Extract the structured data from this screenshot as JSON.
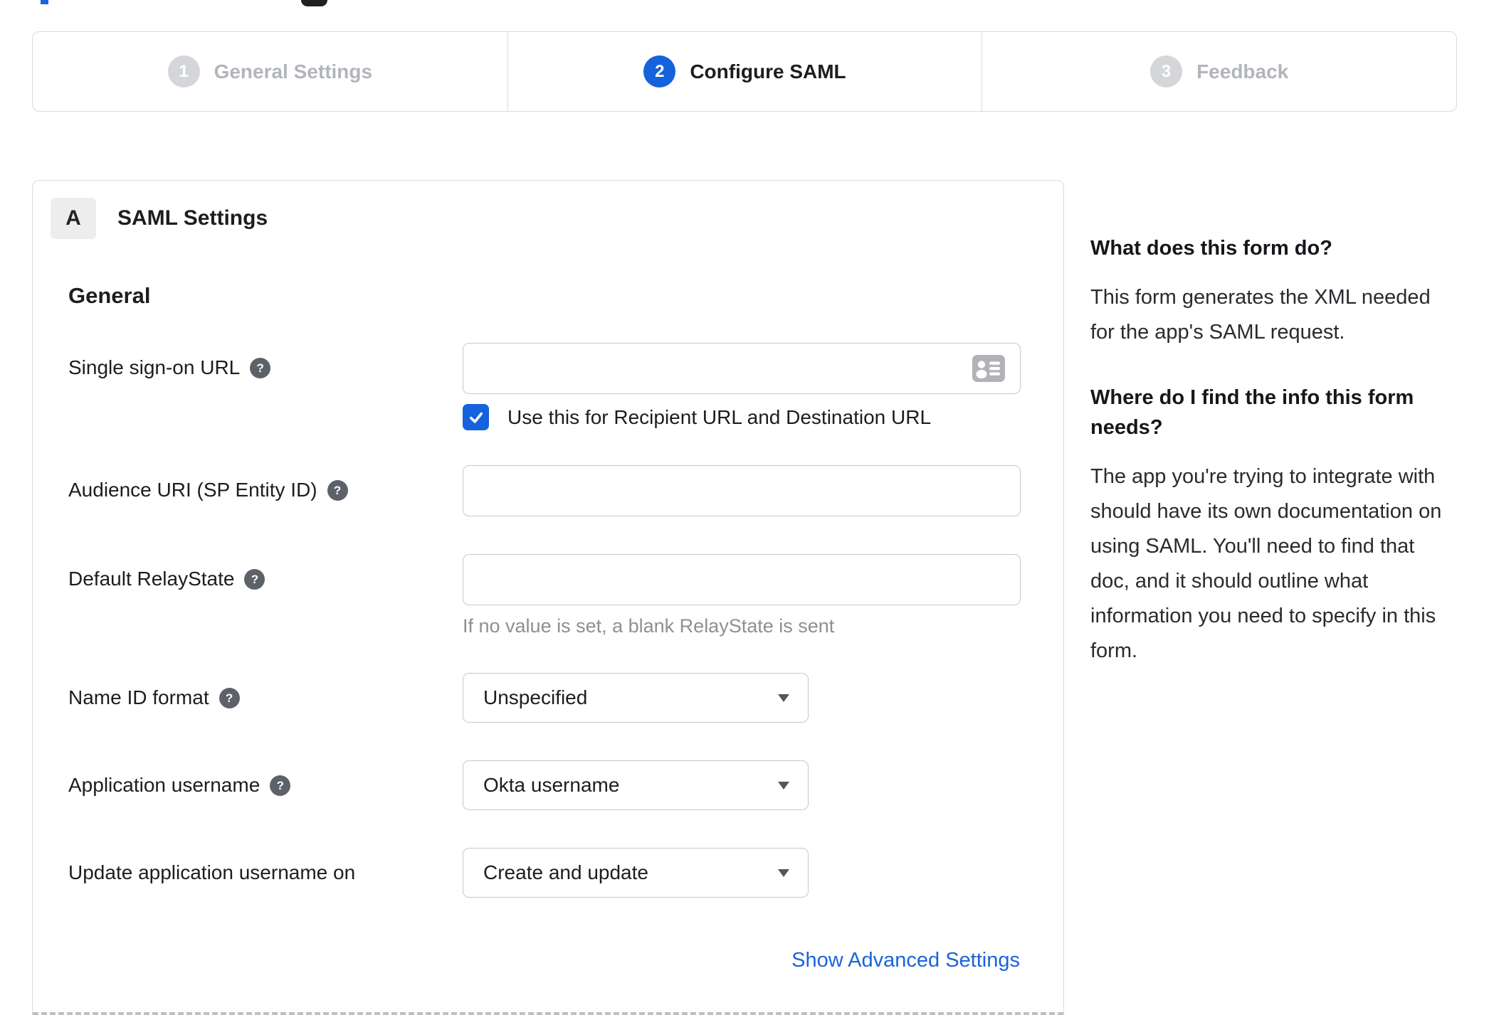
{
  "stepper": {
    "steps": [
      {
        "number": "1",
        "label": "General Settings",
        "state": "inactive"
      },
      {
        "number": "2",
        "label": "Configure SAML",
        "state": "active"
      },
      {
        "number": "3",
        "label": "Feedback",
        "state": "inactive"
      }
    ]
  },
  "panel": {
    "badge": "A",
    "title": "SAML Settings",
    "section_title": "General",
    "fields": {
      "sso_url": {
        "label": "Single sign-on URL",
        "value": "",
        "checkbox_label": "Use this for Recipient URL and Destination URL",
        "checkbox_checked": true
      },
      "audience_uri": {
        "label": "Audience URI (SP Entity ID)",
        "value": ""
      },
      "default_relaystate": {
        "label": "Default RelayState",
        "value": "",
        "hint": "If no value is set, a blank RelayState is sent"
      },
      "name_id_format": {
        "label": "Name ID format",
        "value": "Unspecified"
      },
      "application_username": {
        "label": "Application username",
        "value": "Okta username"
      },
      "update_app_username": {
        "label": "Update application username on",
        "value": "Create and update"
      }
    },
    "advanced_link": "Show Advanced Settings"
  },
  "sidebar": {
    "sections": [
      {
        "heading": "What does this form do?",
        "body": "This form generates the XML needed for the app's SAML request."
      },
      {
        "heading": "Where do I find the info this form needs?",
        "body": "The app you're trying to integrate with should have its own documentation on using SAML. You'll need to find that doc, and it should outline what information you need to specify in this form."
      }
    ]
  },
  "colors": {
    "accent_blue": "#1662dd",
    "link_blue": "#1b63dc",
    "inactive_step_gray": "#d4d6da",
    "border_gray": "#d9d9dd"
  }
}
